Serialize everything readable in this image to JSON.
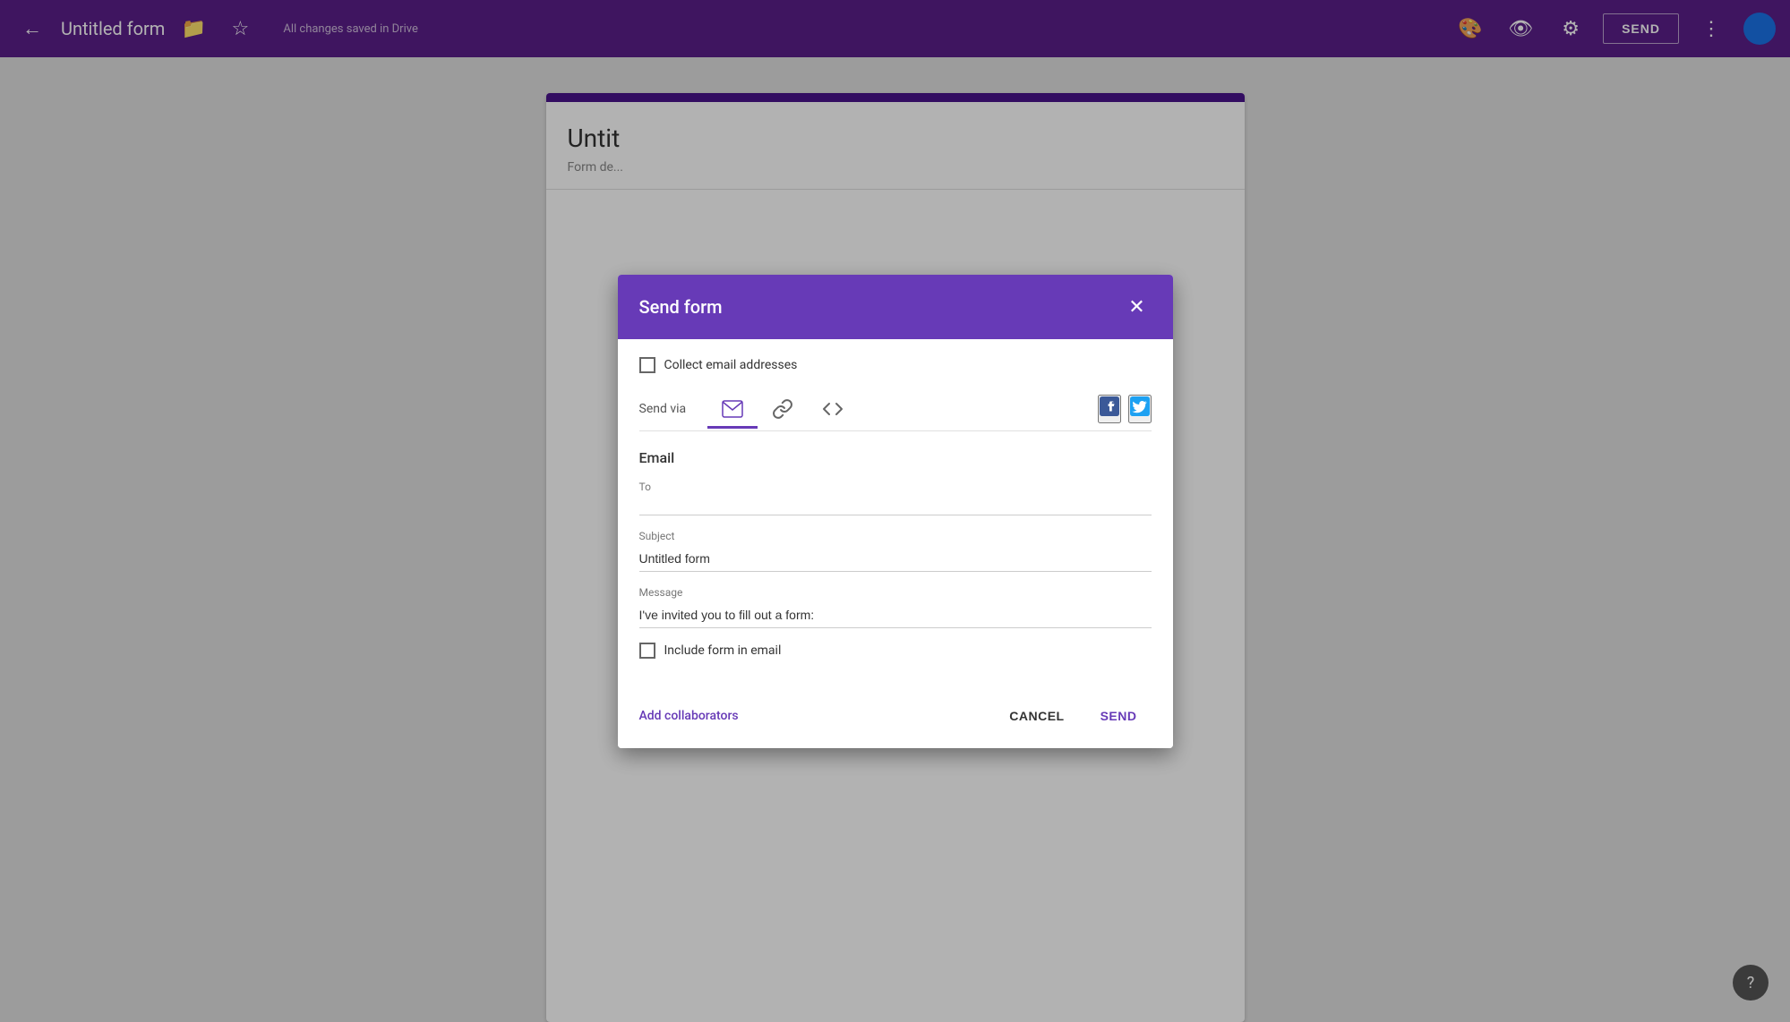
{
  "topbar": {
    "title": "Untitled form",
    "saved_status": "All changes saved in Drive",
    "send_button_label": "SEND",
    "icons": {
      "back": "←",
      "folder": "📁",
      "star": "☆",
      "palette": "🎨",
      "eye": "👁",
      "gear": "⚙",
      "more": "⋮"
    }
  },
  "form_background": {
    "title": "Untit",
    "description": "Form de..."
  },
  "dialog": {
    "title": "Send form",
    "close_icon": "✕",
    "collect_emails_label": "Collect email addresses",
    "send_via_label": "Send via",
    "tabs": [
      {
        "id": "email",
        "icon": "✉",
        "active": true
      },
      {
        "id": "link",
        "icon": "🔗",
        "active": false
      },
      {
        "id": "embed",
        "icon": "<>",
        "active": false
      }
    ],
    "social": {
      "facebook": "f",
      "twitter": "t"
    },
    "email_section": {
      "title": "Email",
      "to_label": "To",
      "to_value": "",
      "to_placeholder": "",
      "subject_label": "Subject",
      "subject_value": "Untitled form",
      "message_label": "Message",
      "message_value": "I've invited you to fill out a form:"
    },
    "include_form_label": "Include form in email",
    "add_collaborators_link": "Add collaborators",
    "cancel_label": "CANCEL",
    "send_label": "SEND"
  },
  "help": {
    "icon": "?"
  }
}
